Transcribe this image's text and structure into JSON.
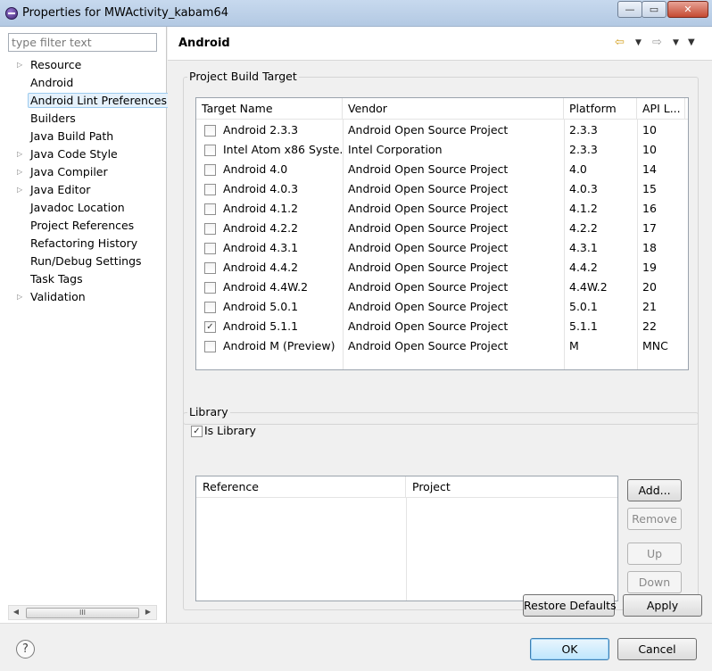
{
  "window": {
    "title": "Properties for MWActivity_kabam64",
    "minimize_glyph": "—",
    "maximize_glyph": "▭",
    "close_glyph": "✕"
  },
  "sidebar": {
    "filter_placeholder": "type filter text",
    "items": [
      {
        "label": "Resource",
        "expandable": true
      },
      {
        "label": "Android",
        "expandable": false
      },
      {
        "label": "Android Lint Preferences",
        "expandable": false,
        "selected": true
      },
      {
        "label": "Builders",
        "expandable": false
      },
      {
        "label": "Java Build Path",
        "expandable": false
      },
      {
        "label": "Java Code Style",
        "expandable": true
      },
      {
        "label": "Java Compiler",
        "expandable": true
      },
      {
        "label": "Java Editor",
        "expandable": true
      },
      {
        "label": "Javadoc Location",
        "expandable": false
      },
      {
        "label": "Project References",
        "expandable": false
      },
      {
        "label": "Refactoring History",
        "expandable": false
      },
      {
        "label": "Run/Debug Settings",
        "expandable": false
      },
      {
        "label": "Task Tags",
        "expandable": false
      },
      {
        "label": "Validation",
        "expandable": true
      }
    ],
    "expander_glyph": "▷",
    "scroll_left": "◀",
    "scroll_right": "▶",
    "scroll_grip": "III"
  },
  "page": {
    "title": "Android",
    "nav_back_icon": "⇦",
    "nav_forward_icon": "⇨",
    "menu_glyph": "▼"
  },
  "build_target": {
    "group_label": "Project Build Target",
    "columns": [
      "Target Name",
      "Vendor",
      "Platform",
      "API L..."
    ],
    "rows": [
      {
        "name": "Android 2.3.3",
        "vendor": "Android Open Source Project",
        "platform": "2.3.3",
        "api": "10",
        "checked": false
      },
      {
        "name": "Intel Atom x86 Syste...",
        "vendor": "Intel Corporation",
        "platform": "2.3.3",
        "api": "10",
        "checked": false
      },
      {
        "name": "Android 4.0",
        "vendor": "Android Open Source Project",
        "platform": "4.0",
        "api": "14",
        "checked": false
      },
      {
        "name": "Android 4.0.3",
        "vendor": "Android Open Source Project",
        "platform": "4.0.3",
        "api": "15",
        "checked": false
      },
      {
        "name": "Android 4.1.2",
        "vendor": "Android Open Source Project",
        "platform": "4.1.2",
        "api": "16",
        "checked": false
      },
      {
        "name": "Android 4.2.2",
        "vendor": "Android Open Source Project",
        "platform": "4.2.2",
        "api": "17",
        "checked": false
      },
      {
        "name": "Android 4.3.1",
        "vendor": "Android Open Source Project",
        "platform": "4.3.1",
        "api": "18",
        "checked": false
      },
      {
        "name": "Android 4.4.2",
        "vendor": "Android Open Source Project",
        "platform": "4.4.2",
        "api": "19",
        "checked": false
      },
      {
        "name": "Android 4.4W.2",
        "vendor": "Android Open Source Project",
        "platform": "4.4W.2",
        "api": "20",
        "checked": false
      },
      {
        "name": "Android 5.0.1",
        "vendor": "Android Open Source Project",
        "platform": "5.0.1",
        "api": "21",
        "checked": false
      },
      {
        "name": "Android 5.1.1",
        "vendor": "Android Open Source Project",
        "platform": "5.1.1",
        "api": "22",
        "checked": true
      },
      {
        "name": "Android M (Preview)",
        "vendor": "Android Open Source Project",
        "platform": "M",
        "api": "MNC",
        "checked": false
      }
    ]
  },
  "library": {
    "group_label": "Library",
    "is_library_label": "Is Library",
    "is_library_checked": true,
    "columns": [
      "Reference",
      "Project"
    ],
    "add_label": "Add...",
    "remove_label": "Remove",
    "up_label": "Up",
    "down_label": "Down"
  },
  "actions": {
    "restore_label": "Restore Defaults",
    "apply_label": "Apply",
    "ok_label": "OK",
    "cancel_label": "Cancel",
    "help_glyph": "?"
  },
  "check_glyph": "✓"
}
